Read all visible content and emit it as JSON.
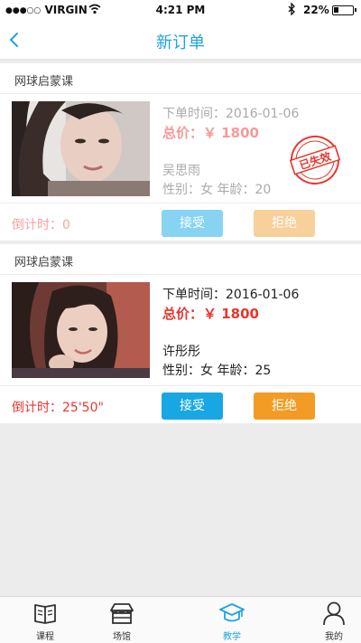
{
  "status_bar": {
    "signal_dots": "●●●○○",
    "carrier": "VIRGIN",
    "time": "4:21 PM",
    "battery_pct": "22%"
  },
  "nav": {
    "title": "新订单",
    "accent_color": "#1fa3e0"
  },
  "orders": [
    {
      "course": "网球启蒙课",
      "order_time": "下单时间：2016-01-06",
      "price": "总价：￥ 1800",
      "name": "吴思雨",
      "gender_age": "性别：女    年龄：20",
      "countdown": "倒计时：0",
      "accept_label": "接受",
      "reject_label": "拒绝",
      "stamp_text": "已失效",
      "expired": true
    },
    {
      "course": "网球启蒙课",
      "order_time": "下单时间：2016-01-06",
      "price": "总价：￥ 1800",
      "name": "许彤彤",
      "gender_age": "性别：女    年龄：25",
      "countdown": "倒计时：25'50\"",
      "accept_label": "接受",
      "reject_label": "拒绝",
      "expired": false
    }
  ],
  "tabs": [
    {
      "label": "课程",
      "icon": "book-icon",
      "active": false
    },
    {
      "label": "场馆",
      "icon": "venue-store-icon",
      "active": false
    },
    {
      "label": "教学",
      "icon": "graduation-cap-icon",
      "active": true
    },
    {
      "label": "我的",
      "icon": "person-icon",
      "active": false
    }
  ]
}
